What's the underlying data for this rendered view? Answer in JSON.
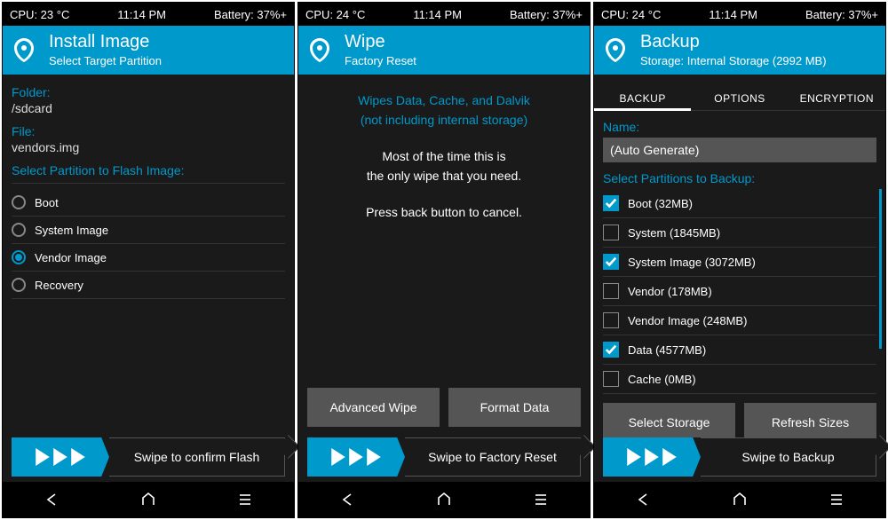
{
  "status": [
    {
      "cpu": "CPU: 23 °C",
      "time": "11:14 PM",
      "batt": "Battery: 37%+"
    },
    {
      "cpu": "CPU: 24 °C",
      "time": "11:14 PM",
      "batt": "Battery: 37%+"
    },
    {
      "cpu": "CPU: 24 °C",
      "time": "11:14 PM",
      "batt": "Battery: 37%+"
    }
  ],
  "install": {
    "title": "Install Image",
    "subtitle": "Select Target Partition",
    "folder_label": "Folder:",
    "folder_value": "/sdcard",
    "file_label": "File:",
    "file_value": "vendors.img",
    "select_label": "Select Partition to Flash Image:",
    "partitions": [
      "Boot",
      "System Image",
      "Vendor Image",
      "Recovery"
    ],
    "selected_index": 2,
    "slider": "Swipe to confirm Flash"
  },
  "wipe": {
    "title": "Wipe",
    "subtitle": "Factory Reset",
    "l1": "Wipes Data, Cache, and Dalvik",
    "l2": "(not including internal storage)",
    "l3": "Most of the time this is",
    "l4": "the only wipe that you need.",
    "l5": "Press back button to cancel.",
    "btn1": "Advanced Wipe",
    "btn2": "Format Data",
    "slider": "Swipe to Factory Reset"
  },
  "backup": {
    "title": "Backup",
    "subtitle": "Storage: Internal Storage (2992 MB)",
    "tabs": [
      "BACKUP",
      "OPTIONS",
      "ENCRYPTION"
    ],
    "active_tab": 0,
    "name_label": "Name:",
    "name_value": "(Auto Generate)",
    "select_label": "Select Partitions to Backup:",
    "partitions": [
      {
        "label": "Boot (32MB)",
        "checked": true
      },
      {
        "label": "System (1845MB)",
        "checked": false
      },
      {
        "label": "System Image (3072MB)",
        "checked": true
      },
      {
        "label": "Vendor (178MB)",
        "checked": false
      },
      {
        "label": "Vendor Image (248MB)",
        "checked": false
      },
      {
        "label": "Data (4577MB)",
        "checked": true
      },
      {
        "label": "Cache (0MB)",
        "checked": false
      }
    ],
    "btn1": "Select Storage",
    "btn2": "Refresh Sizes",
    "slider": "Swipe to Backup"
  }
}
